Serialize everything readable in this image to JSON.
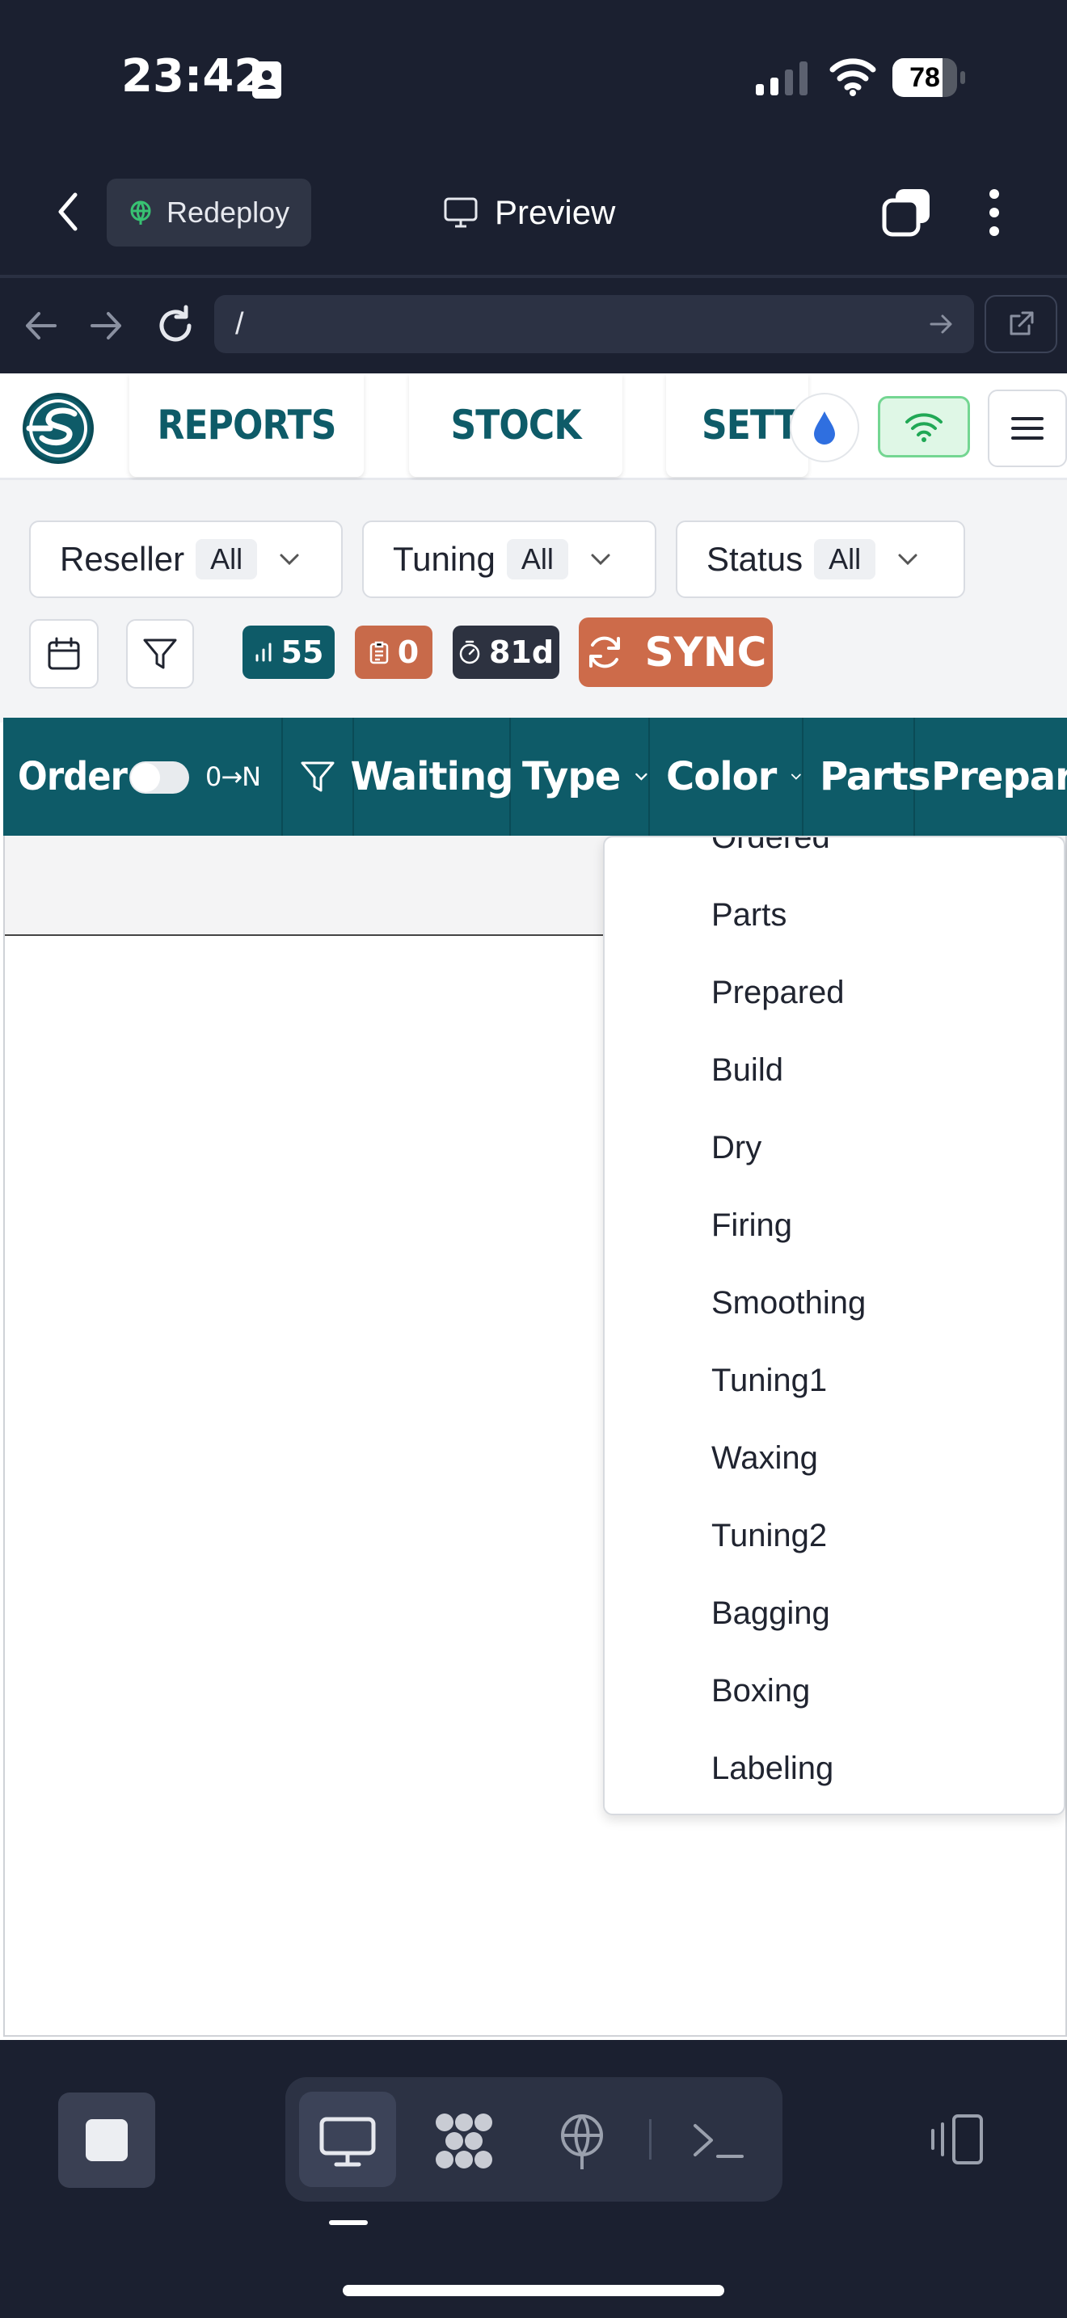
{
  "status_bar": {
    "time": "23:42",
    "battery": "78",
    "battery_level": 0.78
  },
  "browser_chrome": {
    "redeploy_label": "Redeploy",
    "preview_label": "Preview",
    "url": "/"
  },
  "app": {
    "nav_tabs": [
      "REPORTS",
      "STOCK",
      "SETTI"
    ],
    "filters": {
      "reseller": {
        "label": "Reseller",
        "value": "All"
      },
      "tuning": {
        "label": "Tuning",
        "value": "All"
      },
      "status": {
        "label": "Status",
        "value": "All"
      }
    },
    "badges": {
      "count": "55",
      "tasks": "0",
      "days": "81d"
    },
    "sync_label": "SYNC",
    "table": {
      "headers": {
        "order": "Order",
        "sort": "0→N",
        "waiting": "Waiting",
        "type": "Type",
        "color": "Color",
        "parts": "Parts",
        "prepared": "Prepared"
      }
    },
    "status_dropdown": {
      "options": [
        "Ordered",
        "Parts",
        "Prepared",
        "Build",
        "Dry",
        "Firing",
        "Smoothing",
        "Tuning1",
        "Waxing",
        "Tuning2",
        "Bagging",
        "Boxing",
        "Labeling"
      ]
    }
  },
  "colors": {
    "brand": "#0e5b68",
    "accent": "#cd6b4a",
    "dark": "#1b2030"
  },
  "icons": [
    "chevron-left-icon",
    "globe-icon",
    "monitor-icon",
    "tabs-icon",
    "more-vertical-icon",
    "arrow-left-icon",
    "arrow-right-icon",
    "reload-icon",
    "external-link-icon",
    "droplet-icon",
    "wifi-icon",
    "menu-icon",
    "calendar-icon",
    "filter-icon",
    "chart-icon",
    "clipboard-icon",
    "timer-icon",
    "sync-icon",
    "stop-icon",
    "grid-icon",
    "terminal-icon",
    "rotate-icon"
  ]
}
